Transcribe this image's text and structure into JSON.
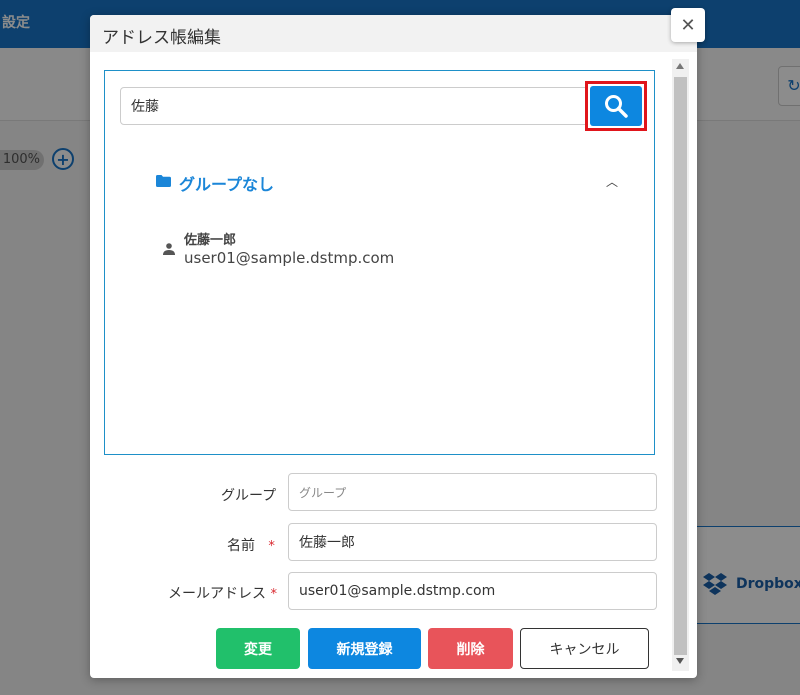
{
  "background": {
    "header_text": "設定",
    "zoom_level": "100%",
    "dropbox_label": "Dropbox"
  },
  "modal": {
    "title": "アドレス帳編集",
    "close_glyph": "✕"
  },
  "search": {
    "value": "佐藤"
  },
  "tree": {
    "group_label": "グループなし",
    "user": {
      "name": "佐藤一郎",
      "email": "user01@sample.dstmp.com"
    }
  },
  "form": {
    "group_label": "グループ",
    "group_placeholder": "グループ",
    "name_label": "名前",
    "name_value": "佐藤一郎",
    "email_label": "メールアドレス",
    "email_value": "user01@sample.dstmp.com",
    "required_mark": "*"
  },
  "buttons": {
    "change": "変更",
    "register": "新規登録",
    "delete": "削除",
    "cancel": "キャンセル"
  },
  "colors": {
    "change": "#21c06b",
    "register": "#0d87e0",
    "delete": "#e8545a",
    "cancel": "#ffffff",
    "highlight": "#e0151b"
  }
}
